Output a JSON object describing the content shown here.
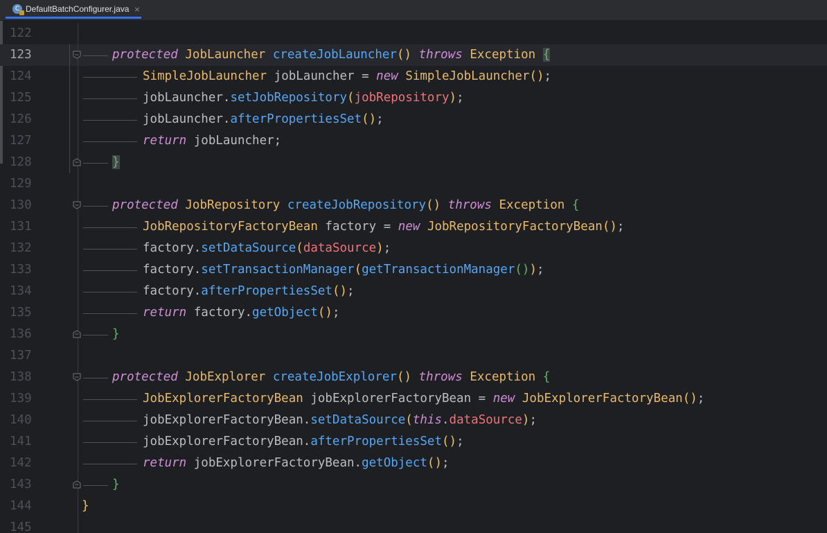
{
  "tab": {
    "icon": "java-class-icon",
    "label": "DefaultBatchConfigurer.java",
    "close": "×"
  },
  "current_line": 123,
  "lines": [
    {
      "n": "122",
      "indent": 0,
      "tokens": []
    },
    {
      "n": "123",
      "indent": 1,
      "fold": true,
      "current": true,
      "tokens": [
        [
          "protected",
          "kw"
        ],
        [
          " ",
          ""
        ],
        [
          "JobLauncher",
          "ty"
        ],
        [
          " ",
          ""
        ],
        [
          "createJobLauncher",
          "fn"
        ],
        [
          "()",
          "pn"
        ],
        [
          " ",
          ""
        ],
        [
          "throws",
          "kw"
        ],
        [
          " ",
          ""
        ],
        [
          "Exception",
          "ty"
        ],
        [
          " ",
          ""
        ],
        [
          "{",
          "pn2 hl"
        ]
      ]
    },
    {
      "n": "124",
      "indent": 2,
      "tokens": [
        [
          "SimpleJobLauncher",
          "ty"
        ],
        [
          " jobLauncher = ",
          ""
        ],
        [
          "new",
          "kw"
        ],
        [
          " ",
          ""
        ],
        [
          "SimpleJobLauncher",
          "ty"
        ],
        [
          "()",
          "pn"
        ],
        [
          ";",
          ""
        ]
      ]
    },
    {
      "n": "125",
      "indent": 2,
      "tokens": [
        [
          "jobLauncher.",
          ""
        ],
        [
          "setJobRepository",
          "fn"
        ],
        [
          "(",
          "pn"
        ],
        [
          "jobRepository",
          "fld"
        ],
        [
          ")",
          "pn"
        ],
        [
          ";",
          ""
        ]
      ]
    },
    {
      "n": "126",
      "indent": 2,
      "tokens": [
        [
          "jobLauncher.",
          ""
        ],
        [
          "afterPropertiesSet",
          "fn"
        ],
        [
          "()",
          "pn"
        ],
        [
          ";",
          ""
        ]
      ]
    },
    {
      "n": "127",
      "indent": 2,
      "tokens": [
        [
          "return",
          "kw"
        ],
        [
          " jobLauncher;",
          ""
        ]
      ]
    },
    {
      "n": "128",
      "indent": 1,
      "fold": true,
      "tokens": [
        [
          "}",
          "pn2 hl"
        ]
      ]
    },
    {
      "n": "129",
      "indent": 0,
      "tokens": []
    },
    {
      "n": "130",
      "indent": 1,
      "fold": true,
      "tokens": [
        [
          "protected",
          "kw"
        ],
        [
          " ",
          ""
        ],
        [
          "JobRepository",
          "ty"
        ],
        [
          " ",
          ""
        ],
        [
          "createJobRepository",
          "fn"
        ],
        [
          "()",
          "pn"
        ],
        [
          " ",
          ""
        ],
        [
          "throws",
          "kw"
        ],
        [
          " ",
          ""
        ],
        [
          "Exception",
          "ty"
        ],
        [
          " ",
          ""
        ],
        [
          "{",
          "pn2"
        ]
      ]
    },
    {
      "n": "131",
      "indent": 2,
      "tokens": [
        [
          "JobRepositoryFactoryBean",
          "ty"
        ],
        [
          " factory = ",
          ""
        ],
        [
          "new",
          "kw"
        ],
        [
          " ",
          ""
        ],
        [
          "JobRepositoryFactoryBean",
          "ty"
        ],
        [
          "()",
          "pn"
        ],
        [
          ";",
          ""
        ]
      ]
    },
    {
      "n": "132",
      "indent": 2,
      "tokens": [
        [
          "factory.",
          ""
        ],
        [
          "setDataSource",
          "fn"
        ],
        [
          "(",
          "pn"
        ],
        [
          "dataSource",
          "fld"
        ],
        [
          ")",
          "pn"
        ],
        [
          ";",
          ""
        ]
      ]
    },
    {
      "n": "133",
      "indent": 2,
      "tokens": [
        [
          "factory.",
          ""
        ],
        [
          "setTransactionManager",
          "fn"
        ],
        [
          "(",
          "pn"
        ],
        [
          "getTransactionManager",
          "fn"
        ],
        [
          "()",
          "pn2"
        ],
        [
          ")",
          "pn"
        ],
        [
          ";",
          ""
        ]
      ]
    },
    {
      "n": "134",
      "indent": 2,
      "tokens": [
        [
          "factory.",
          ""
        ],
        [
          "afterPropertiesSet",
          "fn"
        ],
        [
          "()",
          "pn"
        ],
        [
          ";",
          ""
        ]
      ]
    },
    {
      "n": "135",
      "indent": 2,
      "tokens": [
        [
          "return",
          "kw"
        ],
        [
          " factory.",
          ""
        ],
        [
          "getObject",
          "fn"
        ],
        [
          "()",
          "pn"
        ],
        [
          ";",
          ""
        ]
      ]
    },
    {
      "n": "136",
      "indent": 1,
      "fold": true,
      "tokens": [
        [
          "}",
          "pn2"
        ]
      ]
    },
    {
      "n": "137",
      "indent": 0,
      "tokens": []
    },
    {
      "n": "138",
      "indent": 1,
      "fold": true,
      "tokens": [
        [
          "protected",
          "kw"
        ],
        [
          " ",
          ""
        ],
        [
          "JobExplorer",
          "ty"
        ],
        [
          " ",
          ""
        ],
        [
          "createJobExplorer",
          "fn"
        ],
        [
          "()",
          "pn"
        ],
        [
          " ",
          ""
        ],
        [
          "throws",
          "kw"
        ],
        [
          " ",
          ""
        ],
        [
          "Exception",
          "ty"
        ],
        [
          " ",
          ""
        ],
        [
          "{",
          "pn2"
        ]
      ]
    },
    {
      "n": "139",
      "indent": 2,
      "tokens": [
        [
          "JobExplorerFactoryBean",
          "ty"
        ],
        [
          " jobExplorerFactoryBean = ",
          ""
        ],
        [
          "new",
          "kw"
        ],
        [
          " ",
          ""
        ],
        [
          "JobExplorerFactoryBean",
          "ty"
        ],
        [
          "()",
          "pn"
        ],
        [
          ";",
          ""
        ]
      ]
    },
    {
      "n": "140",
      "indent": 2,
      "tokens": [
        [
          "jobExplorerFactoryBean.",
          ""
        ],
        [
          "setDataSource",
          "fn"
        ],
        [
          "(",
          "pn"
        ],
        [
          "this",
          "kw"
        ],
        [
          ".",
          ""
        ],
        [
          "dataSource",
          "fld"
        ],
        [
          ")",
          "pn"
        ],
        [
          ";",
          ""
        ]
      ]
    },
    {
      "n": "141",
      "indent": 2,
      "tokens": [
        [
          "jobExplorerFactoryBean.",
          ""
        ],
        [
          "afterPropertiesSet",
          "fn"
        ],
        [
          "()",
          "pn"
        ],
        [
          ";",
          ""
        ]
      ]
    },
    {
      "n": "142",
      "indent": 2,
      "tokens": [
        [
          "return",
          "kw"
        ],
        [
          " jobExplorerFactoryBean.",
          ""
        ],
        [
          "getObject",
          "fn"
        ],
        [
          "()",
          "pn"
        ],
        [
          ";",
          ""
        ]
      ]
    },
    {
      "n": "143",
      "indent": 1,
      "fold": true,
      "tokens": [
        [
          "}",
          "pn2"
        ]
      ]
    },
    {
      "n": "144",
      "indent": 0,
      "close": true,
      "tokens": [
        [
          "}",
          "pn"
        ]
      ]
    },
    {
      "n": "145",
      "indent": 0,
      "tokens": []
    }
  ],
  "colors": {
    "background": "#1e1f22",
    "keyword": "#cf8ed6",
    "type": "#e8ba6b",
    "method": "#56a8f5",
    "field": "#f0737a",
    "tab_underline": "#3574f0"
  }
}
